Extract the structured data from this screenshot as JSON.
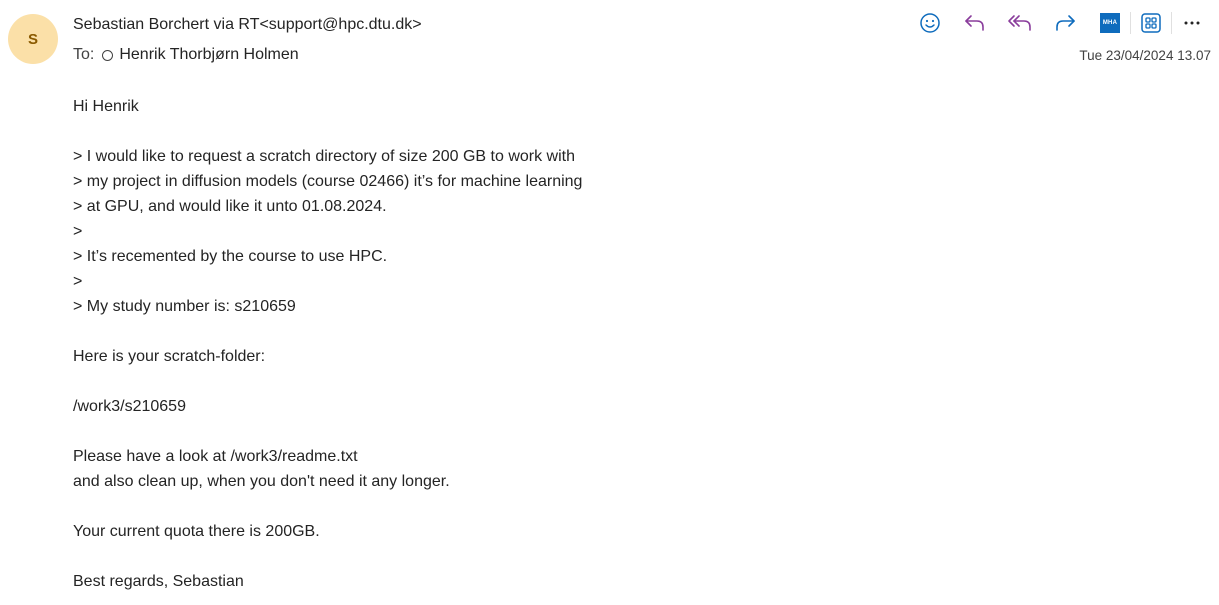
{
  "sender": {
    "initial": "S",
    "display": "Sebastian Borchert via RT<support@hpc.dtu.dk>"
  },
  "recipients": {
    "label": "To:",
    "name": "Henrik Thorbjørn Holmen"
  },
  "date": "Tue 23/04/2024 13.07",
  "toolbar": {
    "mha_label": "MHA",
    "icons": [
      "smiley-icon",
      "reply-icon",
      "reply-all-icon",
      "forward-icon",
      "message-header-analyzer-icon",
      "apps-icon",
      "more-icon"
    ]
  },
  "colors": {
    "accent": "#0f6cbd",
    "reply": "#8a3d9c",
    "avatar_bg": "#fbe0a8"
  },
  "body": [
    "Hi Henrik",
    "",
    "> I would like to request a scratch directory of size 200 GB to work with",
    "> my project in diffusion models (course 02466) it’s for machine learning",
    "> at GPU, and would like it unto 01.08.2024.",
    ">",
    "> It’s recemented by the course to use HPC.",
    ">",
    "> My study number is: s210659",
    "",
    "Here is your scratch-folder:",
    "",
    "/work3/s210659",
    "",
    "Please have a look at /work3/readme.txt",
    "and also clean up, when you don't need it any longer.",
    "",
    "Your current quota there is 200GB.",
    "",
    "Best regards, Sebastian"
  ]
}
